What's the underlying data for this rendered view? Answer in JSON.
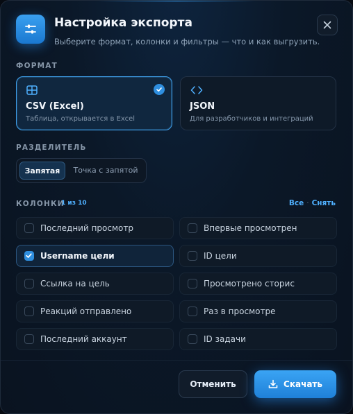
{
  "header": {
    "icon": "sliders-icon",
    "title": "Настройка экспорта",
    "subtitle": "Выберите формат, колонки и фильтры — что и как выгрузить."
  },
  "format": {
    "label": "ФОРМАТ",
    "options": [
      {
        "name": "CSV (Excel)",
        "desc": "Таблица, открывается в Excel",
        "icon": "table-icon",
        "selected": true
      },
      {
        "name": "JSON",
        "desc": "Для разработчиков и интеграций",
        "icon": "code-icon",
        "selected": false
      }
    ]
  },
  "separator": {
    "label": "РАЗДЕЛИТЕЛЬ",
    "options": [
      "Запятая",
      "Точка с запятой"
    ],
    "selected": "Запятая"
  },
  "columns": {
    "label": "КОЛОНКИ",
    "counter": "1 из 10",
    "select_all": "Все",
    "dot": "·",
    "clear": "Снять",
    "items": [
      {
        "label": "Последний просмотр",
        "checked": false
      },
      {
        "label": "Впервые просмотрен",
        "checked": false
      },
      {
        "label": "Username цели",
        "checked": true
      },
      {
        "label": "ID цели",
        "checked": false
      },
      {
        "label": "Ссылка на цель",
        "checked": false
      },
      {
        "label": "Просмотрено сторис",
        "checked": false
      },
      {
        "label": "Реакций отправлено",
        "checked": false
      },
      {
        "label": "Раз в просмотре",
        "checked": false
      },
      {
        "label": "Последний аккаунт",
        "checked": false
      },
      {
        "label": "ID задачи",
        "checked": false
      }
    ]
  },
  "footer": {
    "cancel": "Отменить",
    "download": "Скачать",
    "download_icon": "download-icon"
  },
  "colors": {
    "accent": "#2f8fe0",
    "link": "#4fb0ff",
    "background": "#0a1320"
  }
}
